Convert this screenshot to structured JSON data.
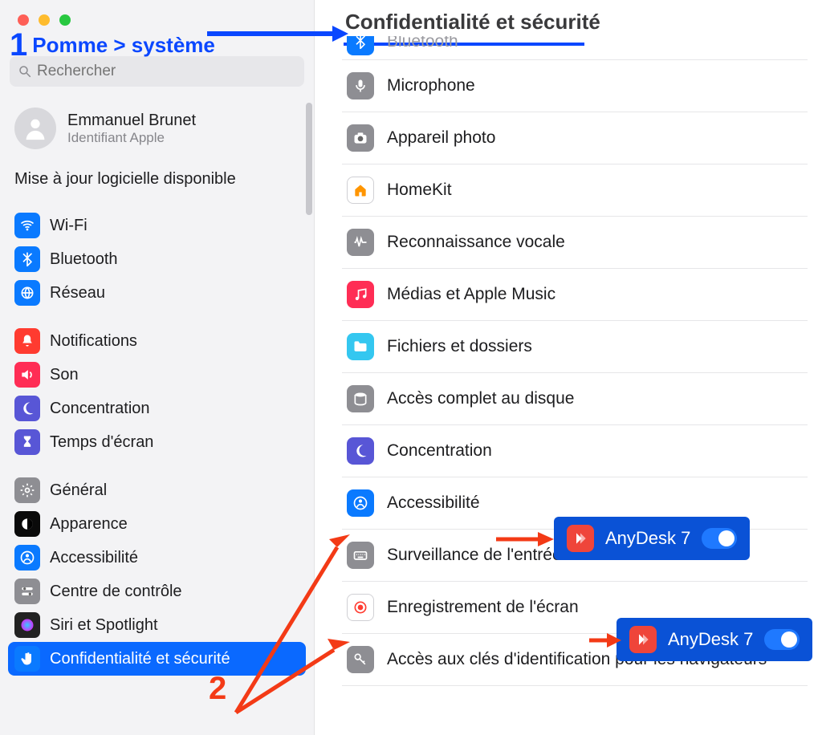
{
  "window": {
    "search_placeholder": "Rechercher"
  },
  "account": {
    "name": "Emmanuel Brunet",
    "sub": "Identifiant Apple"
  },
  "update_notice": "Mise à jour logicielle disponible",
  "sidebar_groups": [
    {
      "items": [
        {
          "key": "wifi",
          "label": "Wi-Fi",
          "icon": "wifi",
          "bg": "#0a7aff"
        },
        {
          "key": "bluetooth",
          "label": "Bluetooth",
          "icon": "bluetooth",
          "bg": "#0a7aff"
        },
        {
          "key": "network",
          "label": "Réseau",
          "icon": "globe",
          "bg": "#0a7aff"
        }
      ]
    },
    {
      "items": [
        {
          "key": "notifications",
          "label": "Notifications",
          "icon": "bell",
          "bg": "#ff3b30"
        },
        {
          "key": "sound",
          "label": "Son",
          "icon": "speaker",
          "bg": "#ff2d55"
        },
        {
          "key": "focus",
          "label": "Concentration",
          "icon": "moon",
          "bg": "#5856d6"
        },
        {
          "key": "screentime",
          "label": "Temps d'écran",
          "icon": "hourglass",
          "bg": "#5856d6"
        }
      ]
    },
    {
      "items": [
        {
          "key": "general",
          "label": "Général",
          "icon": "gear",
          "bg": "#8e8e93"
        },
        {
          "key": "appearance",
          "label": "Apparence",
          "icon": "appearance",
          "bg": "#0a0a0a"
        },
        {
          "key": "accessibility",
          "label": "Accessibilité",
          "icon": "person",
          "bg": "#0a7aff"
        },
        {
          "key": "controlcenter",
          "label": "Centre de contrôle",
          "icon": "switches",
          "bg": "#8e8e93"
        },
        {
          "key": "siri",
          "label": "Siri et Spotlight",
          "icon": "siri",
          "bg": "#222"
        },
        {
          "key": "privacy",
          "label": "Confidentialité et sécurité",
          "icon": "hand",
          "bg": "#0a7aff",
          "selected": true
        }
      ]
    }
  ],
  "page": {
    "title": "Confidentialité et sécurité",
    "rows": [
      {
        "key": "bluetooth",
        "label": "Bluetooth",
        "icon": "bluetooth",
        "bg": "#0a7aff",
        "clipped": true
      },
      {
        "key": "microphone",
        "label": "Microphone",
        "icon": "mic",
        "bg": "#8e8e93"
      },
      {
        "key": "camera",
        "label": "Appareil photo",
        "icon": "camera",
        "bg": "#8e8e93"
      },
      {
        "key": "homekit",
        "label": "HomeKit",
        "icon": "home",
        "bg": "#ffffff",
        "fg": "#ff9500",
        "stroke": true
      },
      {
        "key": "speech",
        "label": "Reconnaissance vocale",
        "icon": "wave",
        "bg": "#8e8e93"
      },
      {
        "key": "media",
        "label": "Médias et Apple Music",
        "icon": "music",
        "bg": "#ff2d55"
      },
      {
        "key": "files",
        "label": "Fichiers et dossiers",
        "icon": "folder",
        "bg": "#34c7f0"
      },
      {
        "key": "fulldisk",
        "label": "Accès complet au disque",
        "icon": "disk",
        "bg": "#8e8e93"
      },
      {
        "key": "focus",
        "label": "Concentration",
        "icon": "moon",
        "bg": "#5856d6"
      },
      {
        "key": "accessibility",
        "label": "Accessibilité",
        "icon": "person",
        "bg": "#0a7aff"
      },
      {
        "key": "inputmon",
        "label": "Surveillance de l'entrée",
        "icon": "keyboard",
        "bg": "#8e8e93"
      },
      {
        "key": "screenrec",
        "label": "Enregistrement de l'écran",
        "icon": "record",
        "bg": "#ffffff",
        "fg": "#ff3b30",
        "stroke": true
      },
      {
        "key": "passkeys",
        "label": "Accès aux clés d'identification pour les navigateurs",
        "icon": "key",
        "bg": "#8e8e93"
      }
    ]
  },
  "annotations": {
    "step1_num": "1",
    "step1_text": "Pomme > système",
    "step2_num": "2",
    "badge_app": "AnyDesk 7"
  }
}
